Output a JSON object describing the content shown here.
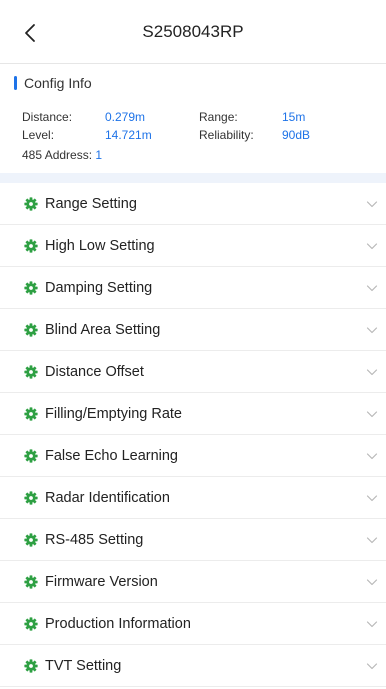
{
  "header": {
    "title": "S2508043RP",
    "back_icon": "chevron-left-icon"
  },
  "config": {
    "title": "Config Info",
    "distance_label": "Distance:",
    "distance_value": "0.279m",
    "range_label": "Range:",
    "range_value": "15m",
    "level_label": "Level:",
    "level_value": "14.721m",
    "reliability_label": "Reliability:",
    "reliability_value": "90dB",
    "address_label": "485 Address:",
    "address_value": "1"
  },
  "settings": [
    {
      "label": "Range Setting"
    },
    {
      "label": "High Low Setting"
    },
    {
      "label": "Damping Setting"
    },
    {
      "label": "Blind Area Setting"
    },
    {
      "label": "Distance Offset"
    },
    {
      "label": "Filling/Emptying Rate"
    },
    {
      "label": "False Echo Learning"
    },
    {
      "label": "Radar Identification"
    },
    {
      "label": "RS-485 Setting"
    },
    {
      "label": "Firmware Version"
    },
    {
      "label": "Production Information"
    },
    {
      "label": "TVT Setting"
    }
  ],
  "colors": {
    "accent": "#1e73e8",
    "icon_green": "#2ea043",
    "band": "#eef3fb"
  },
  "icons": {
    "row_icon": "gear-icon",
    "row_chevron": "chevron-down-icon"
  }
}
